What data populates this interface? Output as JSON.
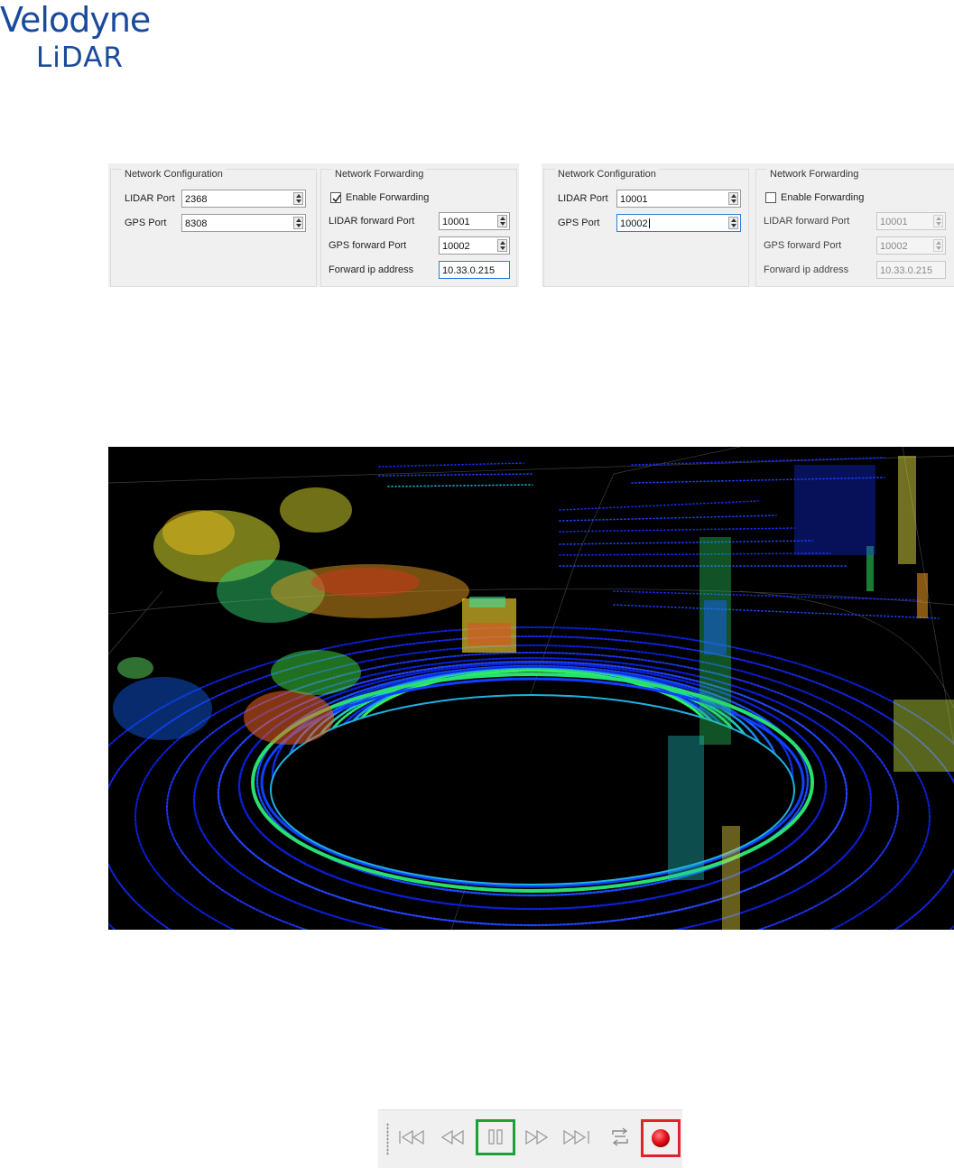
{
  "logo": {
    "line1": "Velodyne",
    "line2": "LiDAR"
  },
  "colors": {
    "brand": "#1a4a9c",
    "focus": "#2a7fd4",
    "highlight_green": "#1aa23a",
    "highlight_red": "#e0222c",
    "record": "#e8131b"
  },
  "panel_a": {
    "network_configuration": {
      "title": "Network Configuration",
      "lidar_port_label": "LIDAR Port",
      "lidar_port_value": "2368",
      "gps_port_label": "GPS Port",
      "gps_port_value": "8308"
    },
    "network_forwarding": {
      "title": "Network Forwarding",
      "enable_label": "Enable Forwarding",
      "enable_checked": true,
      "lidar_forward_port_label": "LIDAR forward Port",
      "lidar_forward_port_value": "10001",
      "gps_forward_port_label": "GPS forward Port",
      "gps_forward_port_value": "10002",
      "forward_ip_label": "Forward ip address",
      "forward_ip_value": "10.33.0.215"
    }
  },
  "panel_b": {
    "network_configuration": {
      "title": "Network Configuration",
      "lidar_port_label": "LIDAR Port",
      "lidar_port_value": "10001",
      "gps_port_label": "GPS Port",
      "gps_port_value": "10002"
    },
    "network_forwarding": {
      "title": "Network Forwarding",
      "enable_label": "Enable Forwarding",
      "enable_checked": false,
      "lidar_forward_port_label": "LIDAR forward Port",
      "lidar_forward_port_value": "10001",
      "gps_forward_port_label": "GPS forward Port",
      "gps_forward_port_value": "10002",
      "forward_ip_label": "Forward ip address",
      "forward_ip_value": "10.33.0.215"
    }
  },
  "playback_toolbar": {
    "buttons": [
      {
        "name": "skip-to-start-icon",
        "highlighted": "none"
      },
      {
        "name": "rewind-icon",
        "highlighted": "none"
      },
      {
        "name": "pause-icon",
        "highlighted": "green"
      },
      {
        "name": "fast-forward-icon",
        "highlighted": "none"
      },
      {
        "name": "skip-to-end-icon",
        "highlighted": "none"
      },
      {
        "name": "loop-icon",
        "highlighted": "none"
      },
      {
        "name": "record-icon",
        "highlighted": "red"
      }
    ]
  }
}
